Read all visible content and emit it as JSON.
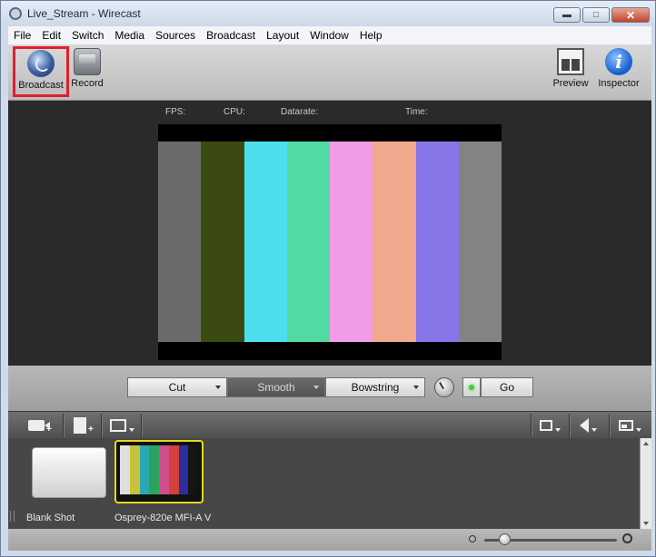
{
  "window": {
    "title": "Live_Stream - Wirecast",
    "controls": [
      "minimize",
      "maximize",
      "close"
    ]
  },
  "menu": [
    "File",
    "Edit",
    "Switch",
    "Media",
    "Sources",
    "Broadcast",
    "Layout",
    "Window",
    "Help"
  ],
  "toolbar": {
    "broadcast_label": "Broadcast",
    "record_label": "Record",
    "preview_label": "Preview",
    "inspector_label": "Inspector"
  },
  "stats": {
    "fps_label": "FPS:",
    "cpu_label": "CPU:",
    "datarate_label": "Datarate:",
    "time_label": "Time:"
  },
  "preview": {
    "bar_colors": [
      "#6b6b6b",
      "#3a4a10",
      "#4bdfee",
      "#52d9a4",
      "#f09ce8",
      "#f0a98c",
      "#8676e8",
      "#838383"
    ]
  },
  "transitions": {
    "cut_label": "Cut",
    "smooth_label": "Smooth",
    "bowstring_label": "Bowstring",
    "go_label": "Go"
  },
  "shots": [
    {
      "name": "Blank Shot"
    },
    {
      "name": "Osprey-820e MFI-A V",
      "thumb_colors": [
        "#dedede",
        "#c8c23a",
        "#2aa9b2",
        "#2aa45c",
        "#d24e8a",
        "#d4403c",
        "#2b2f9c",
        "#141414"
      ]
    }
  ],
  "icons": {
    "add_camera": "video-camera-add-icon",
    "add_media": "document-add-icon",
    "display": "monitor-icon",
    "layer": "square-icon",
    "audio": "speaker-icon",
    "layout": "layout-icon",
    "zoom_out": "zoom-out-icon",
    "zoom_in": "zoom-in-icon"
  },
  "zoom": {
    "level": 0.15
  },
  "accent": {
    "highlight": "#e0202e",
    "selected_shot": "#e4d81c",
    "go_led": "#3bd13b"
  }
}
